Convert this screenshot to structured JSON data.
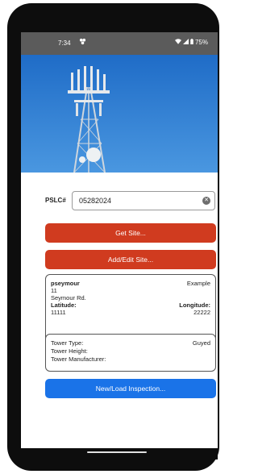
{
  "status_bar": {
    "time": "7:34",
    "battery": "75%",
    "notification_icon": "clover-icon",
    "signal_icons": [
      "wifi-icon",
      "cellular-icon",
      "battery-icon"
    ]
  },
  "hero": {
    "image": "cell-tower-photo",
    "sky_color": "#2f7fd4"
  },
  "pslc": {
    "label": "PSLC#",
    "value": "05282024"
  },
  "buttons": {
    "get_site": "Get Site...",
    "add_edit_site": "Add/Edit Site...",
    "new_load_inspection": "New/Load Inspection..."
  },
  "site_card": {
    "name": "pseymour",
    "tag": "Example",
    "number": "11",
    "street": "Seymour Rd.",
    "latitude_label": "Latitude:",
    "longitude_label": "Longitude:",
    "latitude": "11111",
    "longitude": "22222"
  },
  "tower_card": {
    "type_label": "Tower Type:",
    "type_value": "Guyed",
    "height_label": "Tower Height:",
    "manufacturer_label": "Tower Manufacturer:"
  },
  "colors": {
    "status_bar": "#5b5b5b",
    "primary_red": "#d03b1f",
    "primary_blue": "#1a73e8"
  }
}
